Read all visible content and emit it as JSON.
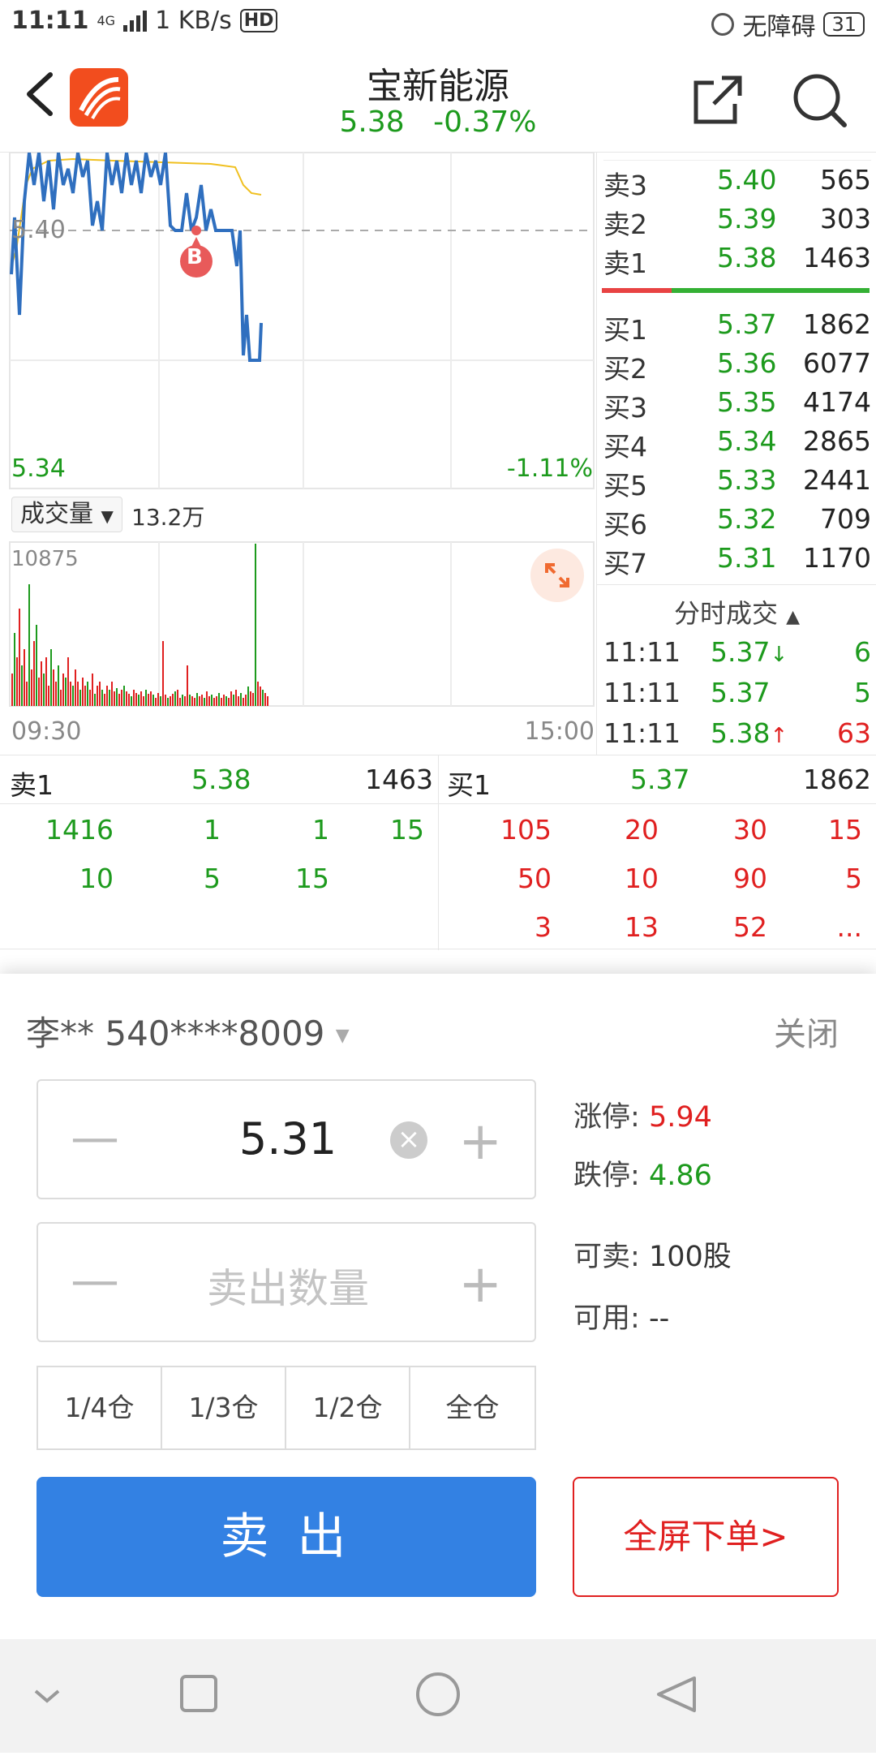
{
  "status": {
    "time": "11:11",
    "net": "4G",
    "speed": "1 KB/s",
    "hd": "HD",
    "access": "无障碍",
    "battery": "31"
  },
  "header": {
    "title": "宝新能源",
    "price": "5.38",
    "change": "-0.37%"
  },
  "chart": {
    "ref_price": "5.40",
    "low_price": "5.34",
    "low_pct": "-1.11%",
    "vol_label": "成交量",
    "vol_value": "13.2万",
    "vol_max": "10875",
    "time_start": "09:30",
    "time_end": "15:00",
    "marker": "B"
  },
  "book": {
    "asks": [
      {
        "name": "卖3",
        "price": "5.40",
        "vol": "565"
      },
      {
        "name": "卖2",
        "price": "5.39",
        "vol": "303"
      },
      {
        "name": "卖1",
        "price": "5.38",
        "vol": "1463"
      }
    ],
    "bids": [
      {
        "name": "买1",
        "price": "5.37",
        "vol": "1862"
      },
      {
        "name": "买2",
        "price": "5.36",
        "vol": "6077"
      },
      {
        "name": "买3",
        "price": "5.35",
        "vol": "4174"
      },
      {
        "name": "买4",
        "price": "5.34",
        "vol": "2865"
      },
      {
        "name": "买5",
        "price": "5.33",
        "vol": "2441"
      },
      {
        "name": "买6",
        "price": "5.32",
        "vol": "709"
      },
      {
        "name": "买7",
        "price": "5.31",
        "vol": "1170"
      }
    ],
    "ticks_title": "分时成交",
    "ticks": [
      {
        "time": "11:11",
        "price": "5.37",
        "arrow": "↓",
        "vol": "6"
      },
      {
        "time": "11:11",
        "price": "5.37",
        "arrow": "",
        "vol": "5"
      },
      {
        "time": "11:11",
        "price": "5.38",
        "arrow": "↑",
        "vol": "63"
      }
    ]
  },
  "l2": {
    "sell_label": "卖1",
    "sell_price": "5.38",
    "sell_vol": "1463",
    "buy_label": "买1",
    "buy_price": "5.37",
    "buy_vol": "1862",
    "sell_rows": [
      [
        "1416",
        "1",
        "1",
        "15"
      ],
      [
        "10",
        "5",
        "15",
        ""
      ]
    ],
    "buy_rows": [
      [
        "105",
        "20",
        "30",
        "15"
      ],
      [
        "50",
        "10",
        "90",
        "5"
      ],
      [
        "3",
        "13",
        "52",
        "..."
      ]
    ]
  },
  "sheet": {
    "account": "李** 540****8009",
    "close": "关闭",
    "price_value": "5.31",
    "qty_placeholder": "卖出数量",
    "limit_up_label": "涨停:",
    "limit_up": "5.94",
    "limit_down_label": "跌停:",
    "limit_down": "4.86",
    "can_sell_label": "可卖:",
    "can_sell": "100股",
    "available_label": "可用:",
    "available": "--",
    "fractions": [
      "1/4仓",
      "1/3仓",
      "1/2仓",
      "全仓"
    ],
    "sell_button": "卖 出",
    "fullscreen_button": "全屏下单>"
  },
  "colors": {
    "up": "#e02020",
    "down": "#1d9a1d",
    "price_line": "#2f6fbf",
    "avg_line": "#f0c020",
    "sell_btn": "#3381e3"
  }
}
